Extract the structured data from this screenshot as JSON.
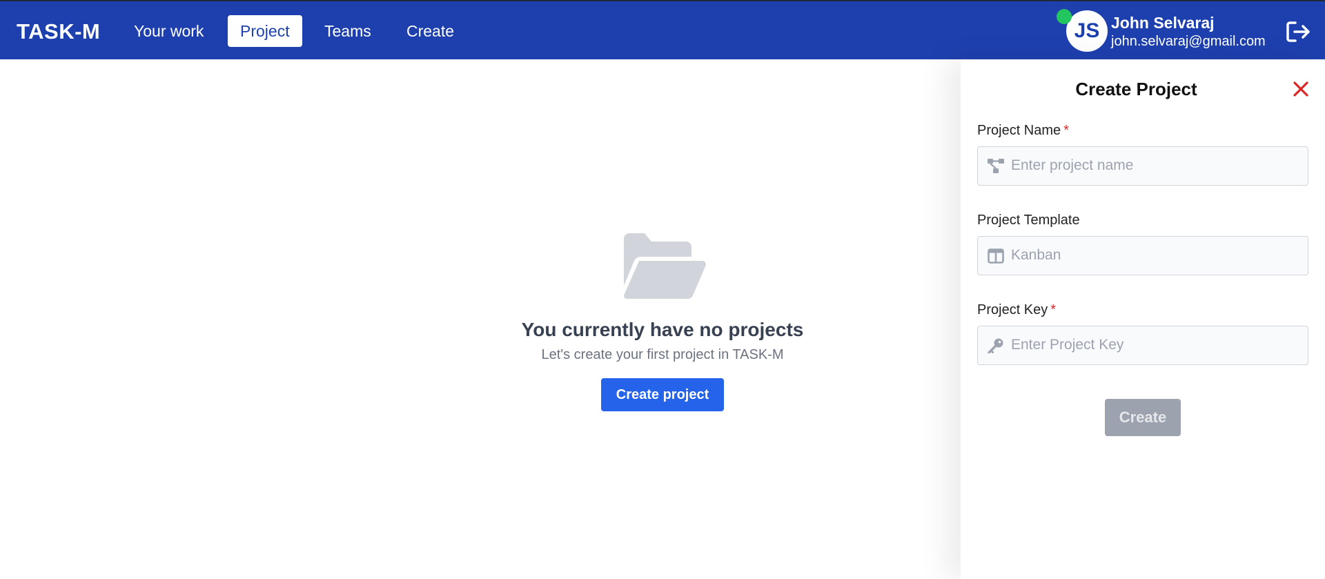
{
  "app": {
    "logo": "TASK-M"
  },
  "nav": {
    "items": [
      {
        "label": "Your work",
        "active": false
      },
      {
        "label": "Project",
        "active": true
      },
      {
        "label": "Teams",
        "active": false
      },
      {
        "label": "Create",
        "active": false
      }
    ]
  },
  "user": {
    "initials": "JS",
    "name": "John Selvaraj",
    "email": "john.selvaraj@gmail.com",
    "status": "online"
  },
  "empty_state": {
    "title": "You currently have no projects",
    "subtitle": "Let's create your first project in TASK-M",
    "button_label": "Create project"
  },
  "create_panel": {
    "title": "Create Project",
    "fields": {
      "name": {
        "label": "Project Name",
        "required_mark": "*",
        "placeholder": "Enter project name",
        "value": ""
      },
      "template": {
        "label": "Project Template",
        "placeholder": "Kanban",
        "value": ""
      },
      "key": {
        "label": "Project Key",
        "required_mark": "*",
        "placeholder": "Enter Project Key",
        "value": ""
      }
    },
    "submit_label": "Create",
    "submit_disabled": true
  },
  "colors": {
    "primary": "#1e40af",
    "button_blue": "#2563eb",
    "disabled": "#9ca3af",
    "danger": "#dc2626",
    "online": "#22c55e"
  }
}
